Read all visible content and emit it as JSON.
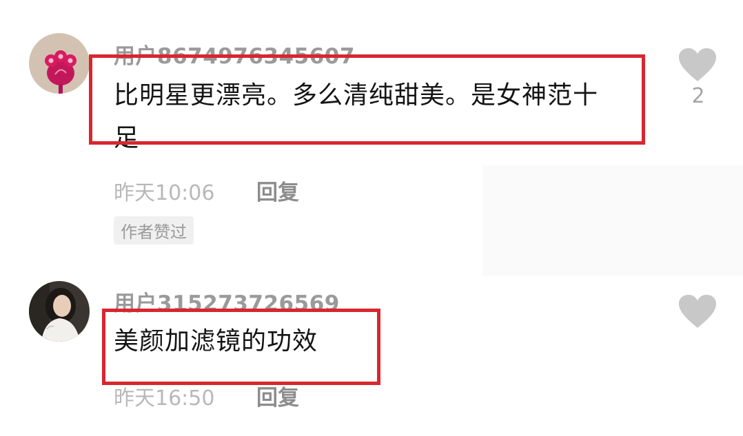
{
  "comments": [
    {
      "username": "用户8674976345607",
      "text_line1": "比明星更漂亮。多么清纯甜美。是女神范十",
      "text_line2": "足",
      "time": "昨天10:06",
      "reply_label": "回复",
      "badge": "作者赞过",
      "like_count": "2",
      "avatar_icon": "flower-avatar-icon"
    },
    {
      "username": "用户315273726569",
      "text": "美颜加滤镜的功效",
      "time": "昨天16:50",
      "reply_label": "回复",
      "avatar_icon": "portrait-avatar-icon"
    }
  ],
  "colors": {
    "highlight": "#d8262f",
    "username": "#9a9a9a",
    "heart": "#c8c8c8"
  }
}
